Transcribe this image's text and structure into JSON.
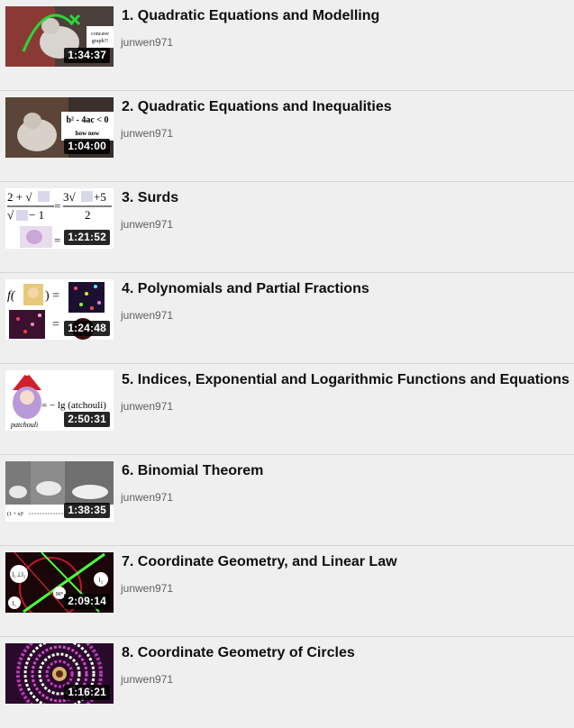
{
  "playlist": {
    "items": [
      {
        "title": "1. Quadratic Equations and Modelling",
        "channel": "junwen971",
        "duration": "1:34:37",
        "thumb_text": [
          "concave",
          "graph?!"
        ]
      },
      {
        "title": "2. Quadratic Equations and Inequalities",
        "channel": "junwen971",
        "duration": "1:04:00",
        "thumb_text": [
          "b² - 4ac < 0",
          "how now"
        ]
      },
      {
        "title": "3. Surds",
        "channel": "junwen971",
        "duration": "1:21:52",
        "thumb_text": [
          "2 + √",
          "3√",
          "+5",
          "√",
          "− 1",
          "2",
          "=",
          "="
        ]
      },
      {
        "title": "4. Polynomials and Partial Fractions",
        "channel": "junwen971",
        "duration": "1:24:48",
        "thumb_text": [
          "f(",
          ") =",
          "="
        ]
      },
      {
        "title": "5. Indices, Exponential and Logarithmic Functions and Equations",
        "channel": "junwen971",
        "duration": "2:50:31",
        "thumb_text": [
          "= − lg (atchouli)",
          "patchouli"
        ]
      },
      {
        "title": "6. Binomial Theorem",
        "channel": "junwen971",
        "duration": "1:38:35",
        "thumb_text": [
          "(1 + x)ⁿ"
        ]
      },
      {
        "title": "7. Coordinate Geometry, and Linear Law",
        "channel": "junwen971",
        "duration": "2:09:14",
        "thumb_text": [
          "l₁⊥l₂",
          "l₂",
          "90°",
          "l₁"
        ]
      },
      {
        "title": "8. Coordinate Geometry of Circles",
        "channel": "junwen971",
        "duration": "1:16:21",
        "thumb_text": []
      }
    ]
  }
}
